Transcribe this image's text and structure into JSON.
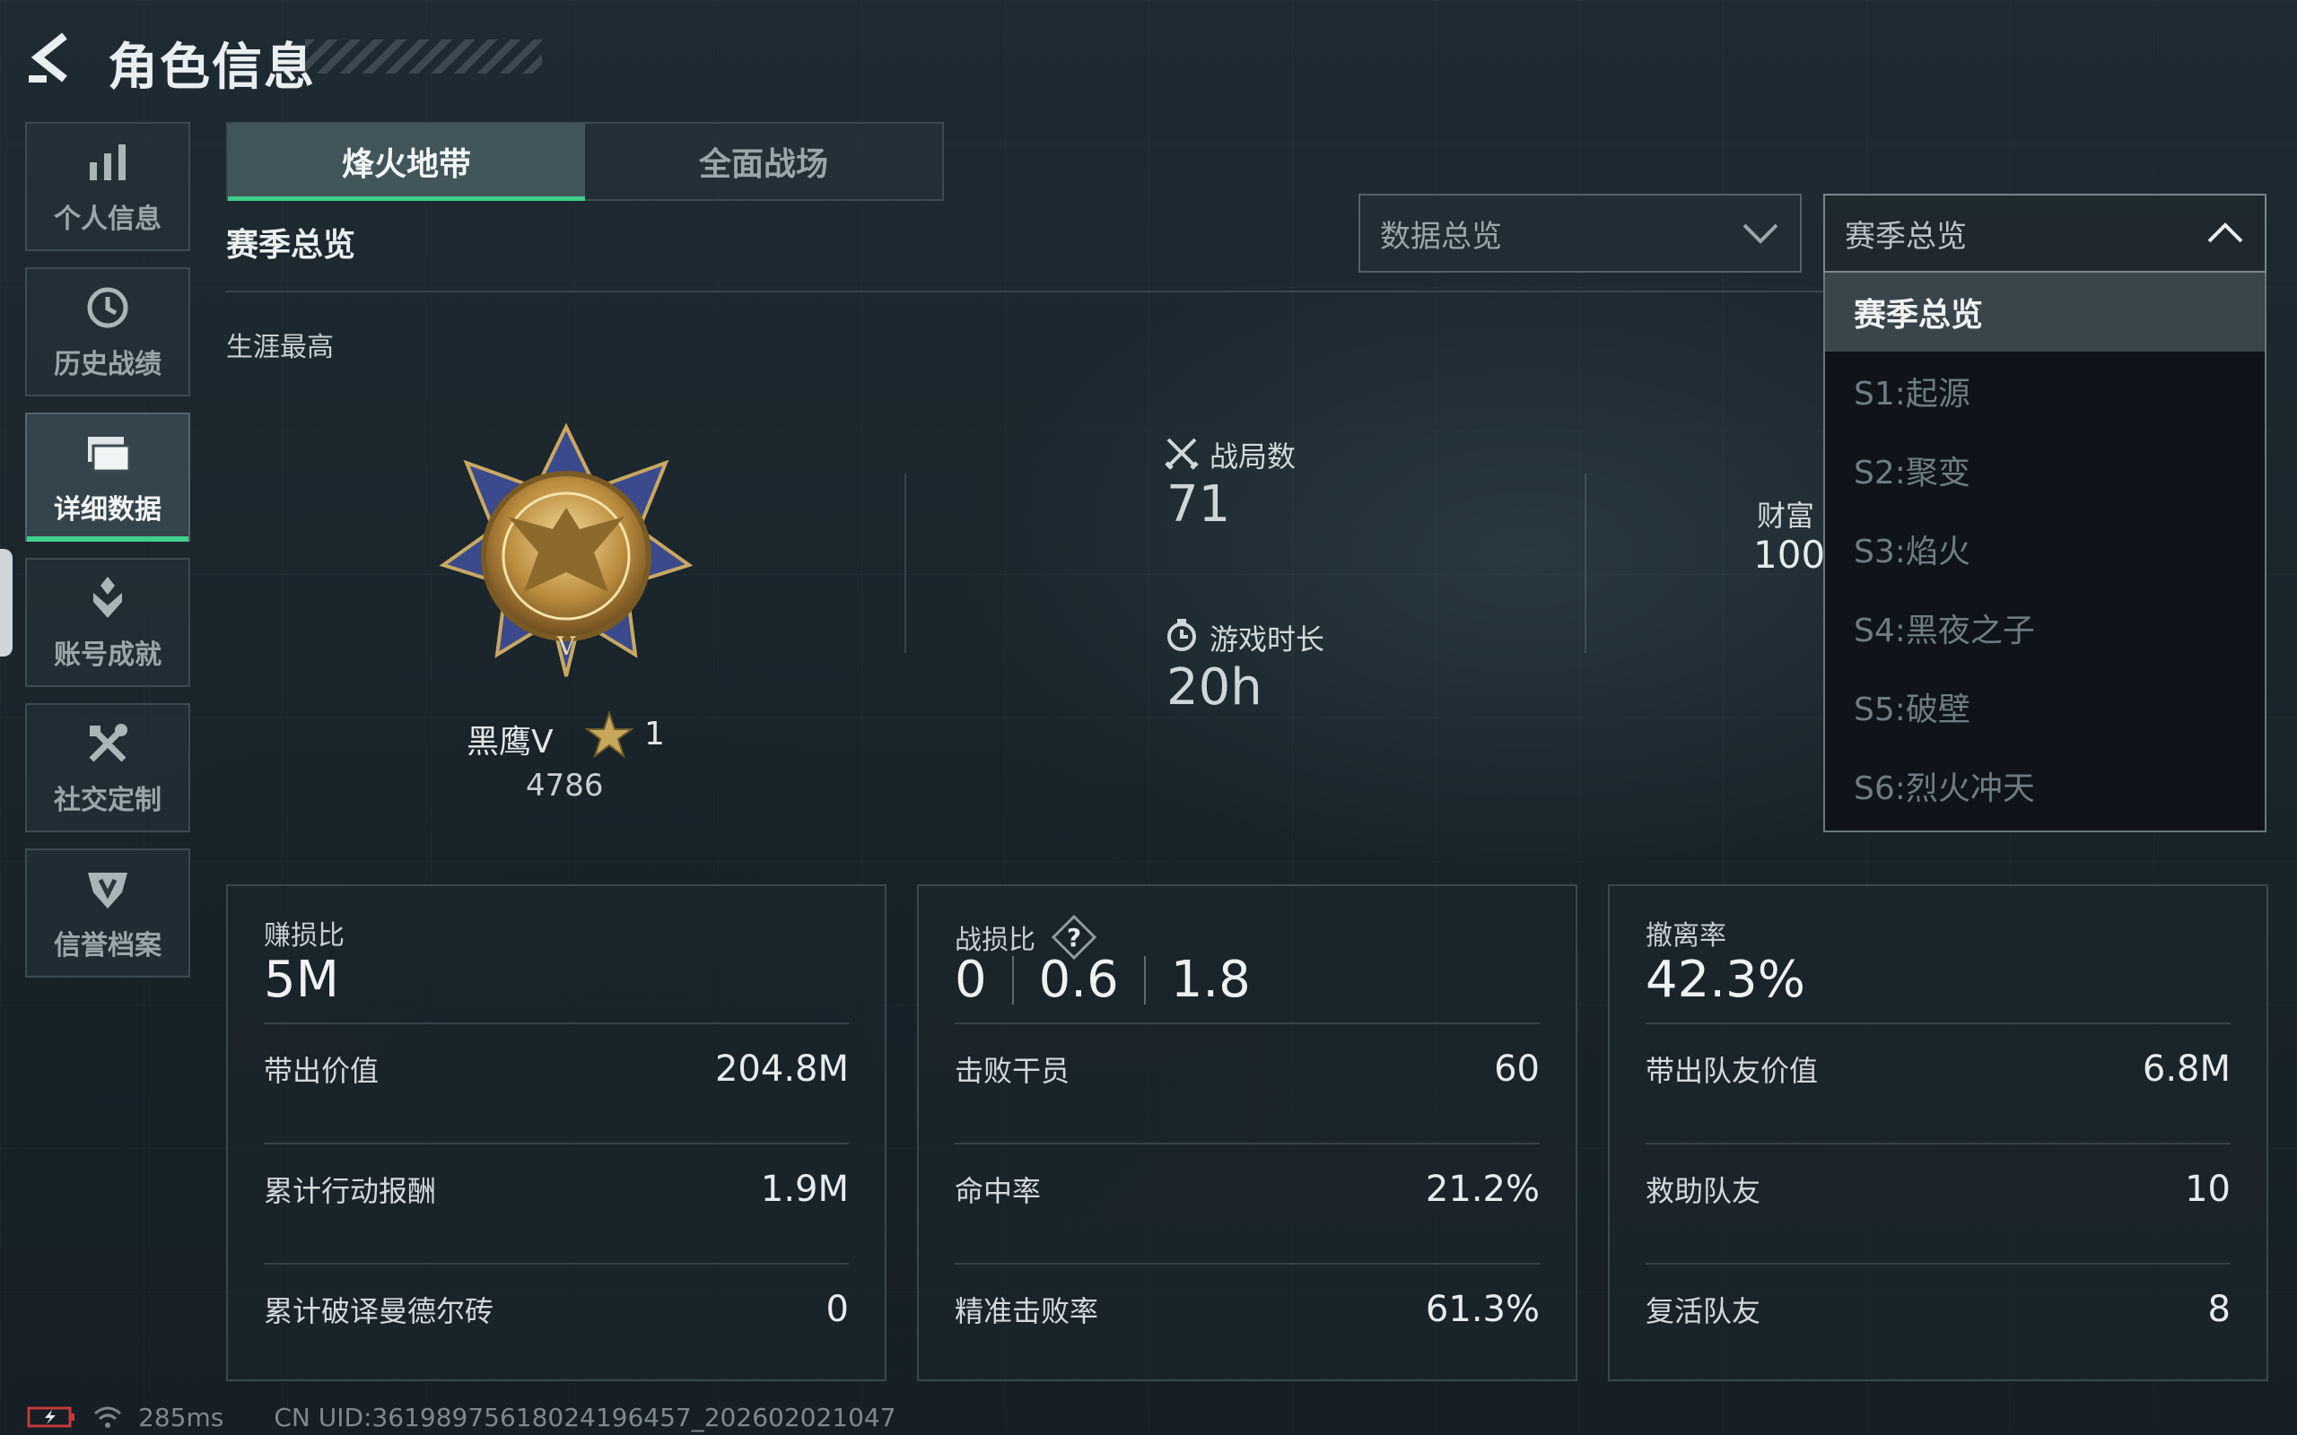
{
  "header": {
    "title": "角色信息"
  },
  "sidebar": {
    "items": [
      {
        "label": "个人信息",
        "icon": "bar-chart-icon"
      },
      {
        "label": "历史战绩",
        "icon": "history-icon"
      },
      {
        "label": "详细数据",
        "icon": "folder-icon",
        "active": true
      },
      {
        "label": "账号成就",
        "icon": "achievement-icon"
      },
      {
        "label": "社交定制",
        "icon": "tools-icon"
      },
      {
        "label": "信誉档案",
        "icon": "shield-icon"
      }
    ]
  },
  "tabs": [
    {
      "label": "烽火地带",
      "active": true
    },
    {
      "label": "全面战场",
      "active": false
    }
  ],
  "main": {
    "section_title": "赛季总览",
    "career_label": "生涯最高"
  },
  "dropdowns": {
    "data_type": {
      "value": "数据总览"
    },
    "season": {
      "value": "赛季总览",
      "options": [
        "赛季总览",
        "S1:起源",
        "S2:聚变",
        "S3:焰火",
        "S4:黑夜之子",
        "S5:破壁",
        "S6:烈火冲天"
      ]
    }
  },
  "rank": {
    "name": "黑鹰V",
    "stars": "1",
    "score": "4786"
  },
  "stats": {
    "matches": {
      "label": "战局数",
      "value": "71"
    },
    "playtime": {
      "label": "游戏时长",
      "value": "20h"
    },
    "wealth": {
      "label": "财富",
      "value_partial": "100"
    }
  },
  "cards": [
    {
      "title": "赚损比",
      "main": "5M",
      "rows": [
        {
          "k": "带出价值",
          "v": "204.8M"
        },
        {
          "k": "累计行动报酬",
          "v": "1.9M"
        },
        {
          "k": "累计破译曼德尔砖",
          "v": "0"
        }
      ]
    },
    {
      "title": "战损比",
      "main_parts": [
        "0",
        "0.6",
        "1.8"
      ],
      "rows": [
        {
          "k": "击败干员",
          "v": "60"
        },
        {
          "k": "命中率",
          "v": "21.2%"
        },
        {
          "k": "精准击败率",
          "v": "61.3%"
        }
      ]
    },
    {
      "title": "撤离率",
      "main": "42.3%",
      "rows": [
        {
          "k": "带出队友价值",
          "v": "6.8M"
        },
        {
          "k": "救助队友",
          "v": "10"
        },
        {
          "k": "复活队友",
          "v": "8"
        }
      ]
    }
  ],
  "footer": {
    "ping": "285ms",
    "uid": "CN UID:361989756180241964​57_202602021047"
  },
  "colors": {
    "accent": "#3fd08a",
    "background": "#1c2830"
  }
}
